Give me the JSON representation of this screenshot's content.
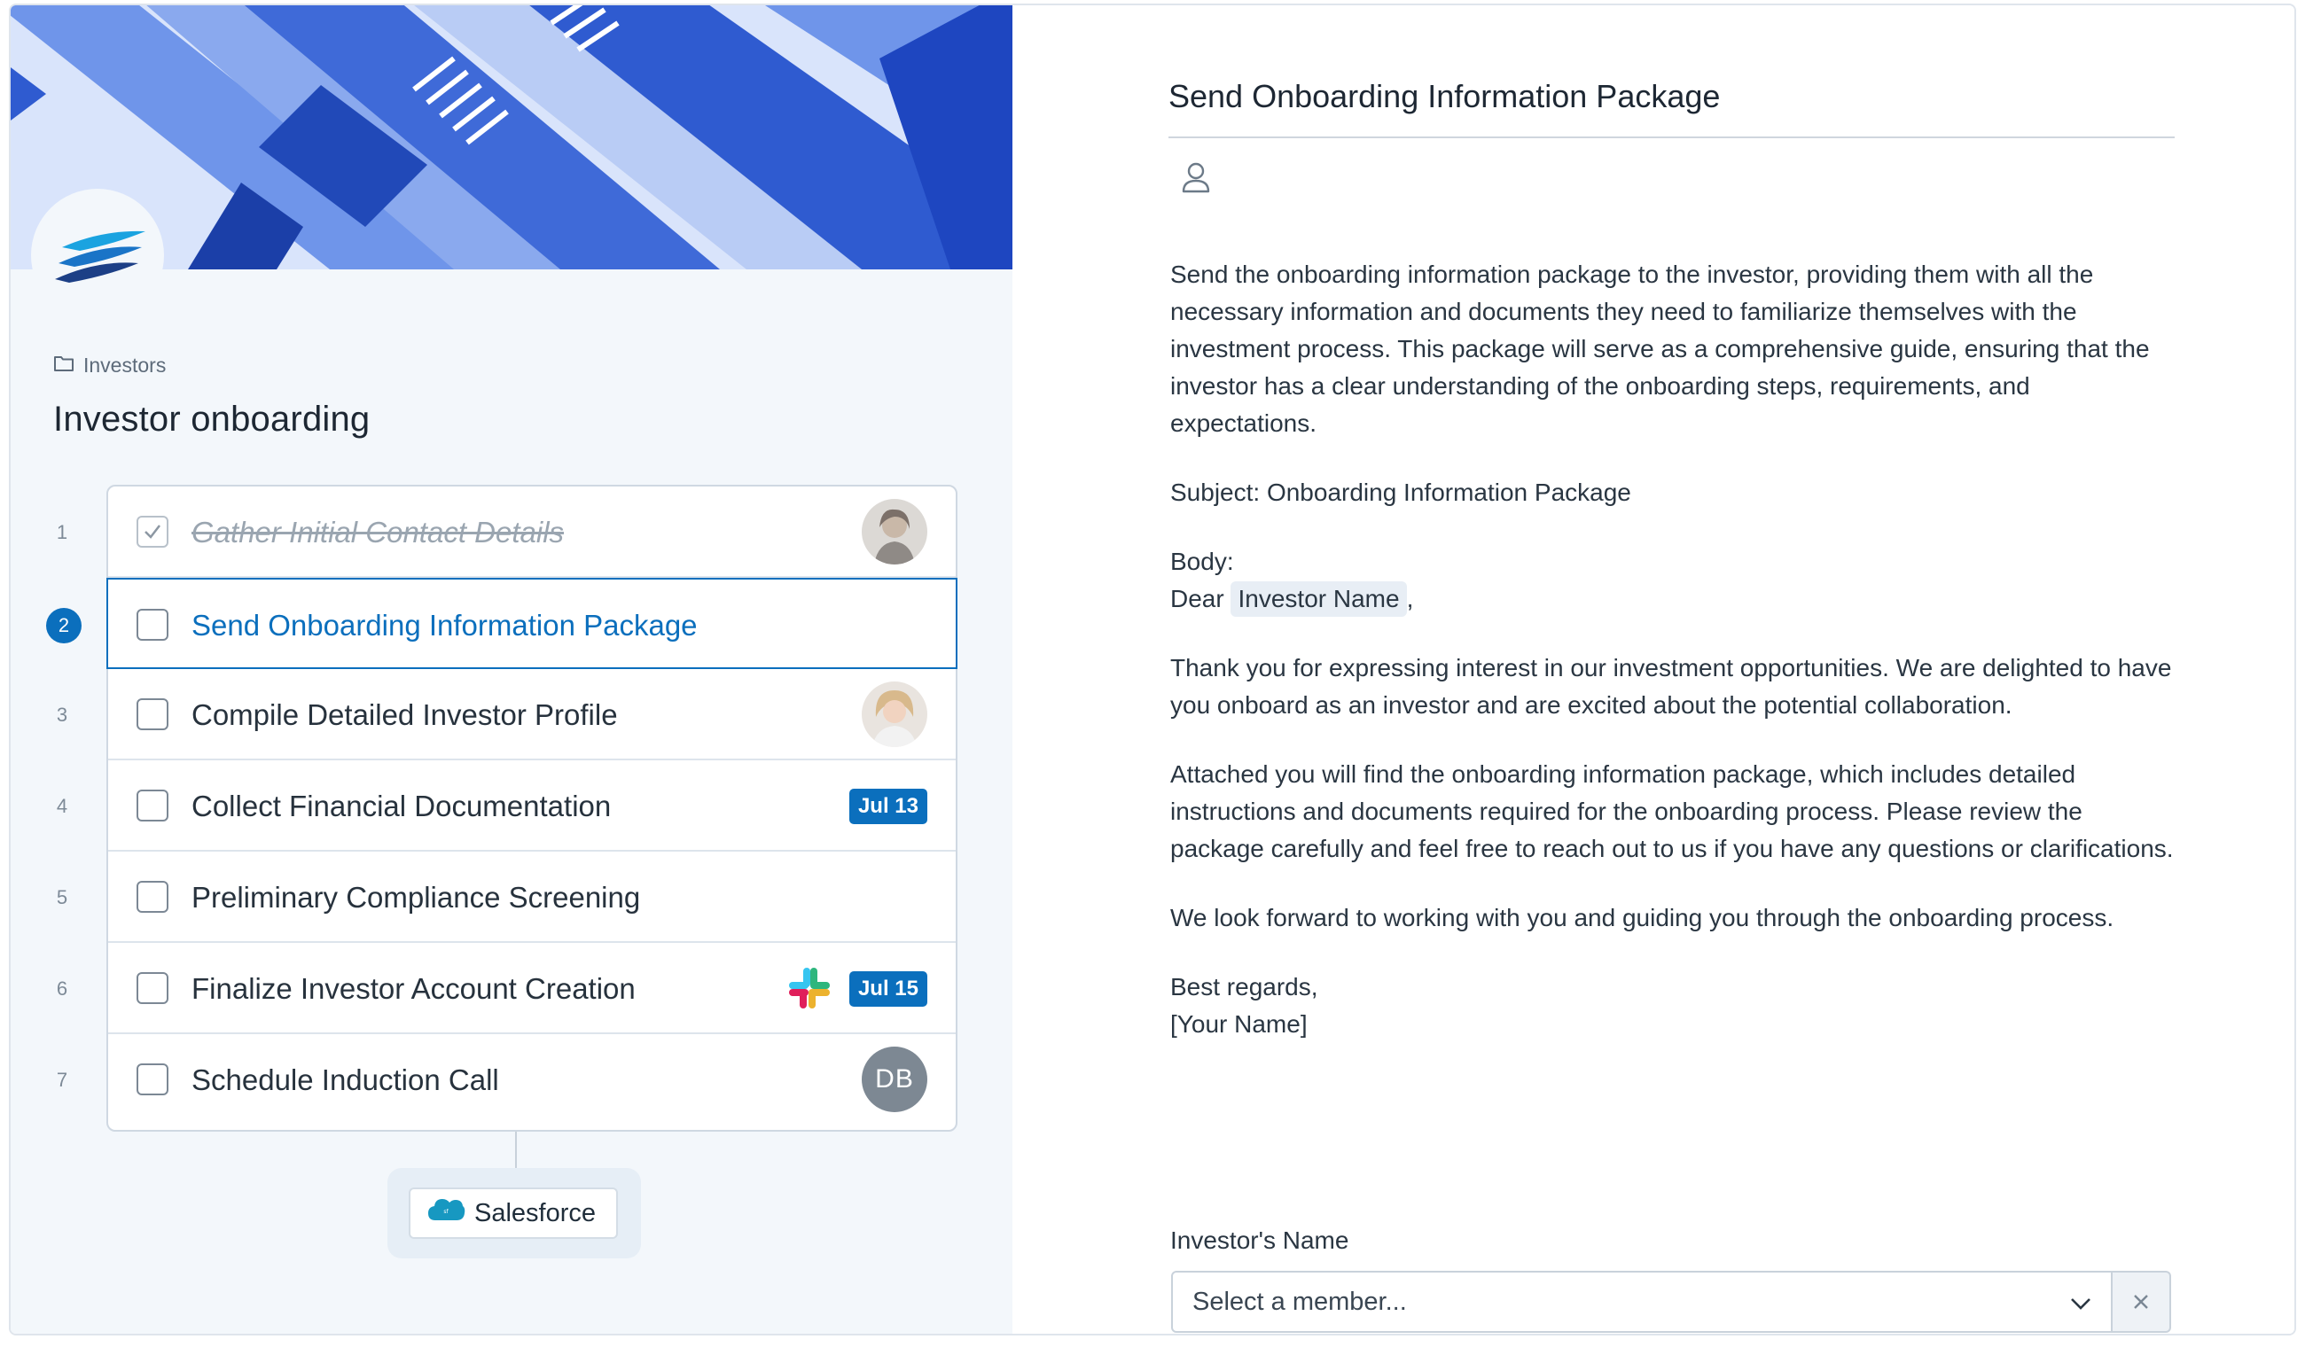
{
  "breadcrumb": {
    "folder_label": "Investors"
  },
  "page": {
    "title": "Investor onboarding"
  },
  "steps": [
    {
      "number": "1",
      "label": "Gather Initial Contact Details",
      "status": "done"
    },
    {
      "number": "2",
      "label": "Send Onboarding Information Package",
      "status": "active"
    },
    {
      "number": "3",
      "label": "Compile Detailed Investor Profile",
      "status": "todo"
    },
    {
      "number": "4",
      "label": "Collect Financial Documentation",
      "status": "todo",
      "due": "Jul 13"
    },
    {
      "number": "5",
      "label": "Preliminary Compliance Screening",
      "status": "todo"
    },
    {
      "number": "6",
      "label": "Finalize Investor Account Creation",
      "status": "todo",
      "due": "Jul 15"
    },
    {
      "number": "7",
      "label": "Schedule Induction Call",
      "status": "todo",
      "assignee_initials": "DB"
    }
  ],
  "integration": {
    "label": "Salesforce"
  },
  "detail": {
    "title": "Send Onboarding Information Package",
    "intro": "Send the onboarding information package to the investor, providing them with all the necessary information and documents they need to familiarize themselves with the investment process. This package will serve as a comprehensive guide, ensuring that the investor has a clear understanding of the onboarding steps, requirements, and expectations.",
    "subject": "Subject: Onboarding Information Package",
    "body_label": "Body:",
    "greeting_prefix": "Dear",
    "greeting_variable": "Investor Name",
    "greeting_suffix": ",",
    "paragraph1": "Thank you for expressing interest in our investment opportunities. We are delighted to have you onboard as an investor and are excited about the potential collaboration.",
    "paragraph2": "Attached you will find the onboarding information package, which includes detailed instructions and documents required for the onboarding process. Please review the package carefully and feel free to reach out to us if you have any questions or clarifications.",
    "paragraph3": "We look forward to working with you and guiding you through the onboarding process.",
    "signoff": "Best regards,",
    "signature": "[Your Name]",
    "field_label": "Investor's Name",
    "select_placeholder": "Select a member..."
  },
  "colors": {
    "accent": "#0b6fbd",
    "panel_bg": "#f3f7fb"
  }
}
